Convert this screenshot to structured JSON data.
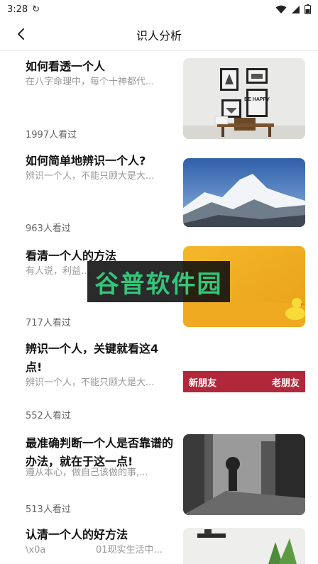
{
  "status": {
    "time": "3:28",
    "sync_glyph": "↻"
  },
  "header": {
    "title": "识人分析"
  },
  "items": [
    {
      "title": "如何看透一个人",
      "summary": "在八字命理中，每个十神都代...",
      "views": "1997人看过"
    },
    {
      "title": "如何简单地辨识一个人?",
      "summary": "辨识一个人，不能只顾大是大...",
      "views": "963人看过"
    },
    {
      "title": "看清一个人的方法",
      "summary": "有人说，利益...",
      "views": "717人看过"
    },
    {
      "title": "辨识一个人，关键就看这4点!",
      "summary": "辨识一个人，不能只顾大是大...",
      "views": "552人看过",
      "banner_left": "新朋友",
      "banner_right": "老朋友"
    },
    {
      "title": "最准确判断一个人是否靠谱的办法，就在于这一点!",
      "summary": "遵从本心，做自己该做的事,...",
      "views": "513人看过"
    },
    {
      "title": "认清一个人的好方法",
      "summary_a": "\\x0a",
      "summary_b": "01现实生活中..."
    }
  ],
  "frame_text": "BE HAPPY",
  "watermark": "谷普软件园",
  "icons": {
    "back": "chevron-left",
    "wifi": "wifi",
    "signal": "signal",
    "battery": "battery"
  }
}
